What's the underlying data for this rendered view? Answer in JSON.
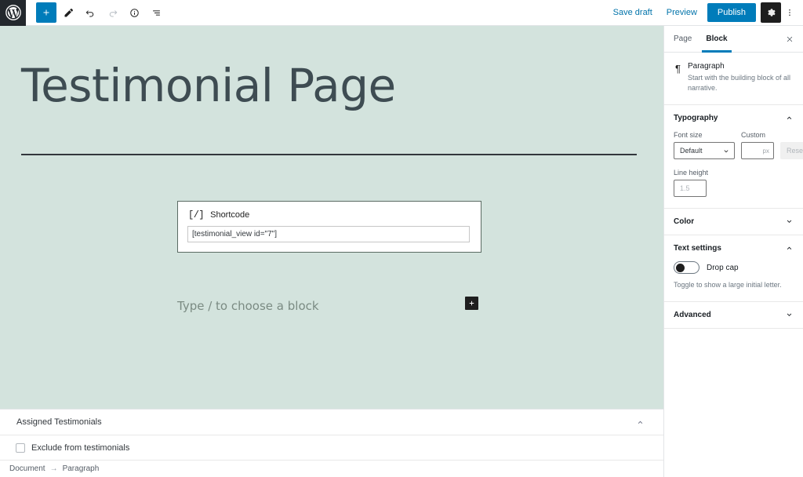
{
  "topbar": {
    "logo_icon": "wordpress-logo",
    "tools": [
      {
        "name": "add-block",
        "icon": "plus-icon",
        "label": "Add block",
        "state": "primary"
      },
      {
        "name": "tools-pencil",
        "icon": "pencil-icon",
        "label": "Tools",
        "state": "default"
      },
      {
        "name": "undo",
        "icon": "undo-arrow-icon",
        "label": "Undo",
        "state": "default"
      },
      {
        "name": "redo",
        "icon": "redo-arrow-icon",
        "label": "Redo",
        "state": "disabled"
      },
      {
        "name": "details",
        "icon": "info-circle-icon",
        "label": "Details",
        "state": "default"
      },
      {
        "name": "list-view",
        "icon": "list-view-icon",
        "label": "List view",
        "state": "default"
      }
    ],
    "save_draft_label": "Save draft",
    "preview_label": "Preview",
    "publish_label": "Publish",
    "settings_icon": "gear-icon",
    "more_icon": "kebab-menu-icon",
    "accent_color": "#007cba"
  },
  "canvas": {
    "background_color": "#d3e3dd",
    "post_title": "Testimonial Page",
    "shortcode_block": {
      "icon": "[/]",
      "label": "Shortcode",
      "value": "[testimonial_view id=\"7\"]"
    },
    "paragraph_placeholder": "Type / to choose a block",
    "inline_adder_icon": "plus-icon"
  },
  "metabox": {
    "title": "Assigned Testimonials",
    "toggle_icon": "chevron-up-icon",
    "checkbox_label": "Exclude from testimonials",
    "checkbox_checked": false
  },
  "statusbar": {
    "breadcrumb": [
      "Document",
      "Paragraph"
    ],
    "separator": "→"
  },
  "sidebar": {
    "tabs": [
      {
        "label": "Page",
        "active": false
      },
      {
        "label": "Block",
        "active": true
      }
    ],
    "close_icon": "close-icon",
    "block_card": {
      "icon": "¶",
      "name": "Paragraph",
      "description": "Start with the building block of all narrative."
    },
    "panels": [
      {
        "title": "Typography",
        "expanded": true,
        "icon": "chevron-up-icon"
      },
      {
        "title": "Color",
        "expanded": false,
        "icon": "chevron-down-icon"
      },
      {
        "title": "Text settings",
        "expanded": true,
        "icon": "chevron-up-icon"
      },
      {
        "title": "Advanced",
        "expanded": false,
        "icon": "chevron-down-icon"
      }
    ],
    "typography": {
      "font_size_label": "Font size",
      "font_size_value": "Default",
      "custom_label": "Custom",
      "custom_value": "",
      "custom_unit": "px",
      "reset_label": "Reset",
      "line_height_label": "Line height",
      "line_height_placeholder": "1.5",
      "line_height_value": ""
    },
    "text_settings": {
      "drop_cap_label": "Drop cap",
      "drop_cap_on": false,
      "help_text": "Toggle to show a large initial letter."
    }
  }
}
